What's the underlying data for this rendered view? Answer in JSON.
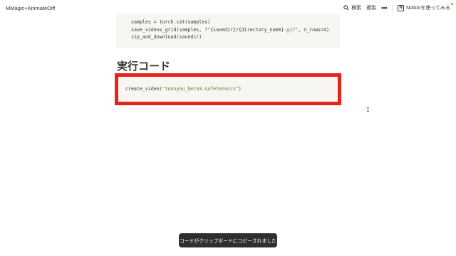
{
  "header": {
    "title": "MMagic+AnimateDiff",
    "search_label": "検索",
    "duplicate_label": "複製",
    "more_label": "•••",
    "notion_logo": "N",
    "try_notion_label": "Notionを使ってみる"
  },
  "code_block_1": {
    "line1": "samples = torch.cat(samples)",
    "line2_a": "save_videos_grid(samples, ",
    "line2_str_a": "f\"",
    "line2_mid": "{savedir}/{directory_name}",
    "line2_str_b": ".gif\"",
    "line2_b": ", n_rows=4)",
    "line3": "zip_and_download(savedir)"
  },
  "section": {
    "heading": "実行コード"
  },
  "code_block_2": {
    "func": "create_video(",
    "arg": "\"toonyou_beta3.safetensors\"",
    "close": ")"
  },
  "cursor": {
    "glyph": "I"
  },
  "toast": {
    "message": "コードがクリップボードにコピーされました"
  },
  "colors": {
    "highlight": "#e3261b",
    "code_bg": "#f7f6f3",
    "string": "#4d8a1f",
    "toast_bg": "#2f2f2f",
    "notify_dot": "#e8852e"
  }
}
